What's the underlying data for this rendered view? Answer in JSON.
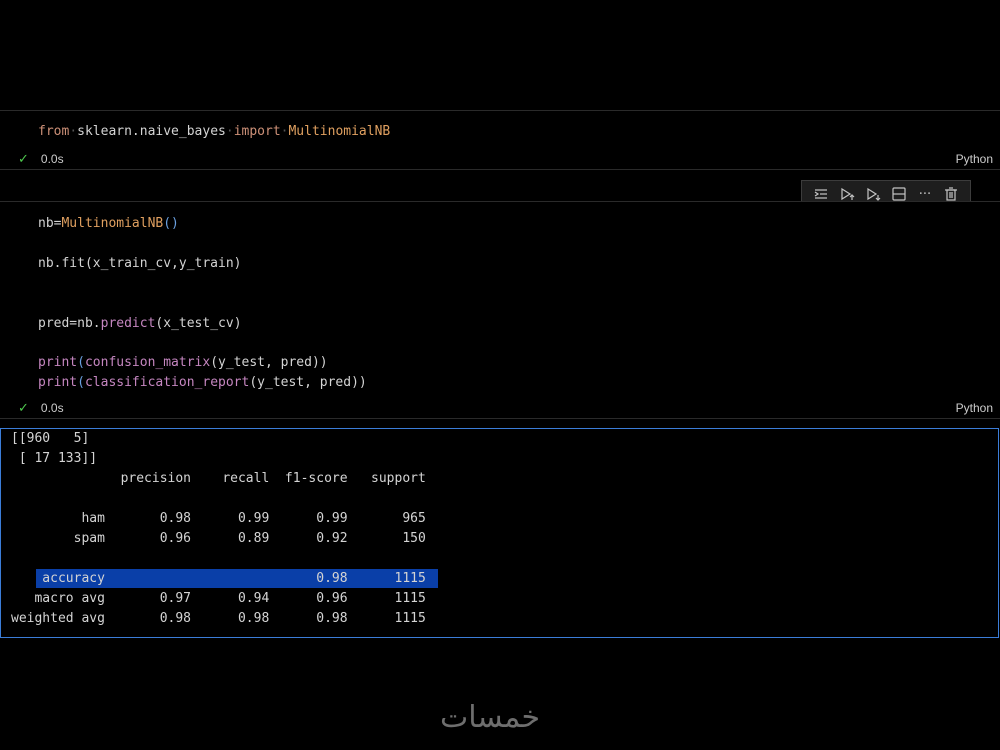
{
  "cells": [
    {
      "code": {
        "tok_from": "from",
        "tok_mod": "sklearn.naive_bayes",
        "tok_import": "import",
        "tok_cls": "MultinomialNB"
      },
      "status": {
        "time": "0.0s",
        "language": "Python"
      }
    },
    {
      "lines": {
        "l1_var": "nb=",
        "l1_cls": "MultinomialNB",
        "l1_paren": "()",
        "l2": "nb.fit(x_train_cv,y_train)",
        "l3_var": "pred=nb.",
        "l3_fn": "predict",
        "l3_rest": "(x_test_cv)",
        "l4_fn": "print",
        "l4_p1": "(",
        "l4_fn2": "confusion_matrix",
        "l4_rest": "(y_test, pred))",
        "l5_fn": "print",
        "l5_p1": "(",
        "l5_fn2": "classification_report",
        "l5_rest": "(y_test, pred))"
      },
      "status": {
        "time": "0.0s",
        "language": "Python"
      }
    }
  ],
  "toolbar": {
    "icons": [
      "run-by-line-icon",
      "execute-above-icon",
      "execute-below-icon",
      "split-cell-icon",
      "more-icon",
      "delete-icon"
    ],
    "more_label": "···"
  },
  "output": {
    "lines": [
      "[[960   5]",
      " [ 17 133]]",
      "              precision    recall  f1-score   support",
      "",
      "         ham       0.98      0.99      0.99       965",
      "        spam       0.96      0.89      0.92       150",
      "",
      "    accuracy                           0.98      1115",
      "   macro avg       0.97      0.94      0.96      1115",
      "weighted avg       0.98      0.98      0.98      1115"
    ]
  },
  "watermark": "خمسات",
  "colors": {
    "background": "#000000",
    "keyword": "#ce9178",
    "highlight": "#0a3fa8",
    "check": "#4ec94e",
    "focus_border": "#3b7dd8"
  }
}
